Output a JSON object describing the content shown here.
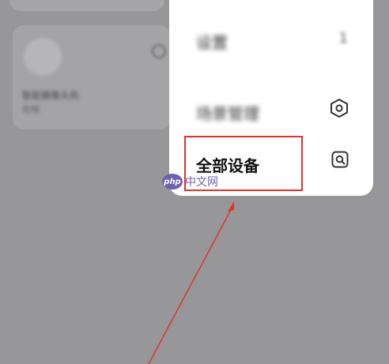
{
  "background_card": {
    "device_name": "智能摄像头机",
    "device_status": "在线"
  },
  "menu": {
    "items": [
      {
        "label": "设置",
        "value": "1",
        "icon": "none"
      },
      {
        "label": "场景管理",
        "icon": "hexagon-icon"
      },
      {
        "label": "全部设备",
        "icon": "scan-device-icon"
      }
    ]
  },
  "watermark": {
    "badge": "php",
    "text": "中文网"
  },
  "colors": {
    "highlight": "#e0322e",
    "watermark": "#6f60b0",
    "overlay": "#979799"
  }
}
